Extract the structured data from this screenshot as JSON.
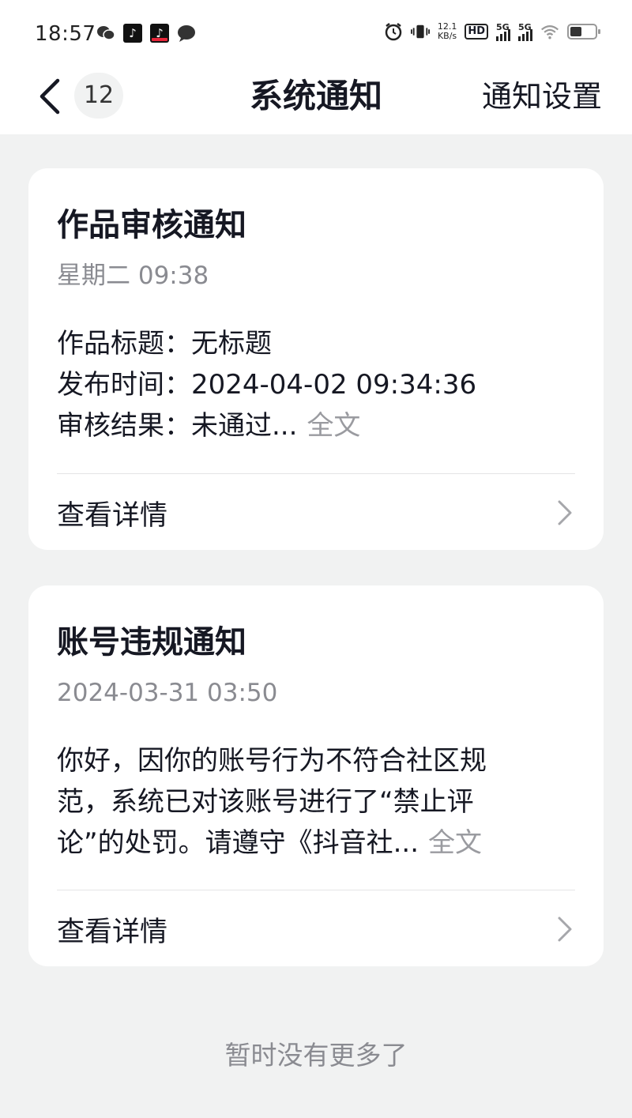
{
  "status_bar": {
    "time": "18:57",
    "net_speed_value": "12.1",
    "net_speed_unit": "KB/s",
    "hd_label": "HD",
    "sim1_label": "5G",
    "sim2_label": "5G",
    "icons": [
      "wechat-icon",
      "douyin-icon",
      "douyin-lite-icon",
      "message-icon",
      "alarm-icon",
      "vibrate-icon",
      "hd-icon",
      "signal-icon",
      "wifi-icon",
      "battery-icon"
    ]
  },
  "nav": {
    "unread_count": "12",
    "title": "系统通知",
    "settings_label": "通知设置"
  },
  "notifications": [
    {
      "title": "作品审核通知",
      "time": "星期二 09:38",
      "fields": [
        {
          "key": "作品标题：",
          "value": "无标题"
        },
        {
          "key": "发布时间：",
          "value": "2024-04-02 09:34:36"
        },
        {
          "key": "审核结果：",
          "value": "未通过..."
        }
      ],
      "more_label": "全文",
      "detail_label": "查看详情"
    },
    {
      "title": "账号违规通知",
      "time": "2024-03-31 03:50",
      "body_lines": [
        "你好，因你的账号行为不符合社区规",
        "范，系统已对该账号进行了“禁止评",
        "论”的处罚。请遵守《抖音社..."
      ],
      "more_label": "全文",
      "detail_label": "查看详情"
    }
  ],
  "footer": {
    "end_text": "暂时没有更多了"
  },
  "colors": {
    "background": "#f1f2f2",
    "card": "#ffffff",
    "primary_text": "#161823",
    "secondary_text": "#8a8b91"
  }
}
